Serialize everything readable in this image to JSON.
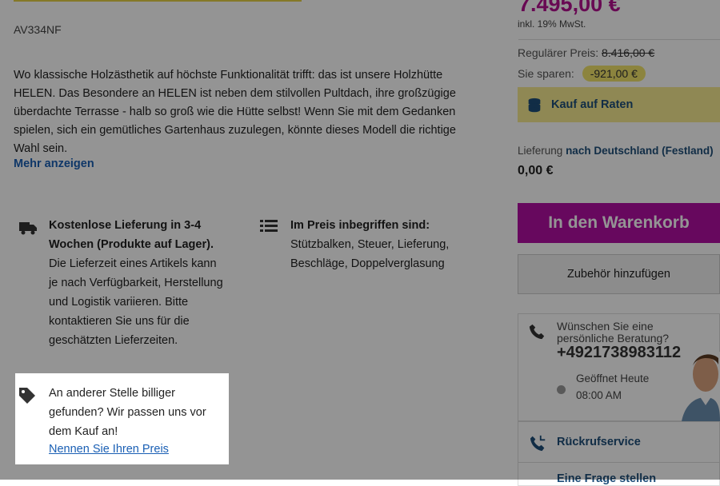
{
  "product": {
    "sku": "AV334NF",
    "description": "Wo klassische Holzästhetik auf höchste Funktionalität trifft: das ist unsere Holzhütte HELEN. Das Besondere an HELEN ist neben dem stilvollen Pultdach, ihre großzügige überdachte Terrasse - halb so groß wie die Hütte selbst! Wenn Sie mit dem Gedanken spielen, sich ein gemütliches Gartenhaus zuzulegen, könnte dieses Modell die richtige Wahl sein.",
    "more_link": "Mehr anzeigen"
  },
  "features": {
    "delivery": {
      "icon": "truck-icon",
      "title": "Kostenlose Lieferung in 3-4 Wochen (Produkte auf Lager).",
      "text": "Die Lieferzeit eines Artikels kann je nach Verfügbarkeit, Herstellung und Logistik variieren. Bitte kontaktieren Sie uns für die geschätzten Lieferzeiten."
    },
    "included": {
      "icon": "list-icon",
      "title": "Im Preis inbegriffen sind:",
      "text": "Stützbalken, Steuer, Lieferung, Beschläge, Doppelverglasung"
    },
    "price_match": {
      "icon": "tag-icon",
      "text": "An anderer Stelle billiger gefunden? Wir passen uns vor dem Kauf an!",
      "link": "Nennen Sie Ihren Preis"
    }
  },
  "pricing": {
    "price": "7.495,00 €",
    "vat": "inkl. 19% MwSt.",
    "regular_label": "Regulärer Preis:",
    "regular_value": "8.416,00 €",
    "save_label": "Sie sparen:",
    "save_value": "-921,00 €",
    "installment_label": "Kauf auf Raten",
    "delivery_prefix": "Lieferung",
    "delivery_dest": "nach Deutschland (Festland)",
    "delivery_price": "0,00 €"
  },
  "actions": {
    "cart": "In den Warenkorb",
    "accessories": "Zubehör hinzufügen"
  },
  "advice": {
    "title": "Wünschen Sie eine persönliche Beratung?",
    "phone": "+4921738983112",
    "open_label": "Geöffnet Heute",
    "hours": "08:00 AM",
    "callback": "Rückrufservice",
    "next_label": "Eine Frage stellen"
  },
  "colors": {
    "accent": "#b10ea3",
    "link": "#1a5fb4",
    "highlight": "#f1e46b"
  }
}
